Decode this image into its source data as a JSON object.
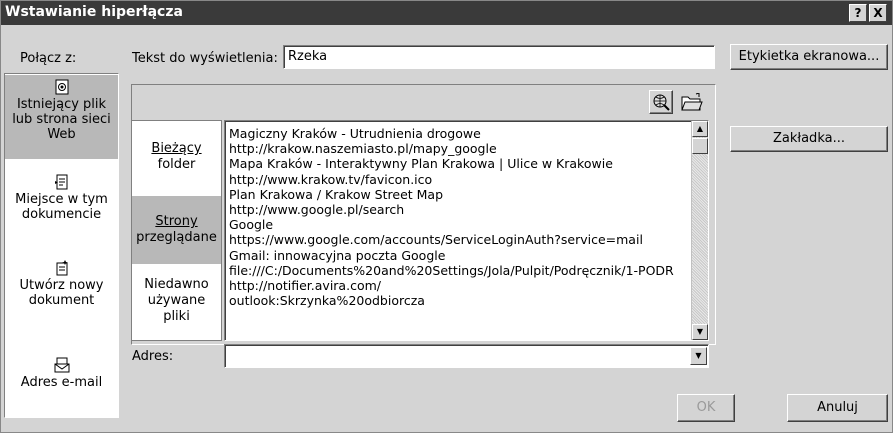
{
  "window": {
    "title": "Wstawianie hiperłącza",
    "help_button": "?",
    "close_button": "X"
  },
  "link_to": {
    "label": "Połącz z:",
    "items": [
      {
        "label_line1": "Istniejący plik",
        "label_line2": "lub strona sieci",
        "label_line3": "Web",
        "selected": true
      },
      {
        "label_line1": "Miejsce w tym",
        "label_line2": "dokumencie"
      },
      {
        "label_line1": "Utwórz nowy",
        "label_line2": "dokument"
      },
      {
        "label_line1": "Adres e-mail"
      }
    ]
  },
  "text_to_display": {
    "label": "Tekst do wyświetlenia:",
    "value": "Rzeka"
  },
  "screentip_button": "Etykietka ekranowa...",
  "bookmark_button": "Zakładka...",
  "look_in": {
    "items": [
      {
        "line1": "Bieżący",
        "line2": "folder"
      },
      {
        "line1": "Strony",
        "line2": "przeglądane",
        "selected": true
      },
      {
        "line1": "Niedawno",
        "line2": "używane",
        "line3": "pliki"
      }
    ]
  },
  "file_list": [
    "Magiczny Kraków - Utrudnienia drogowe",
    "http://krakow.naszemiasto.pl/mapy_google",
    "Mapa Kraków - Interaktywny Plan Krakowa | Ulice w Krakowie",
    "http://www.krakow.tv/favicon.ico",
    "Plan Krakowa / Krakow Street Map",
    "http://www.google.pl/search",
    "Google",
    "https://www.google.com/accounts/ServiceLoginAuth?service=mail",
    "Gmail: innowacyjna poczta Google",
    "file:///C:/Documents%20and%20Settings/Jola/Pulpit/Podręcznik/1-PODR",
    "http://notifier.avira.com/",
    "outlook:Skrzynka%20odbiorcza"
  ],
  "address": {
    "label": "Adres:",
    "value": ""
  },
  "ok_button": "OK",
  "cancel_button": "Anuluj",
  "colors": {
    "titlebar": "#3a3a3a",
    "dialog": "#d4d4d4",
    "selected": "#b8b8b8"
  }
}
